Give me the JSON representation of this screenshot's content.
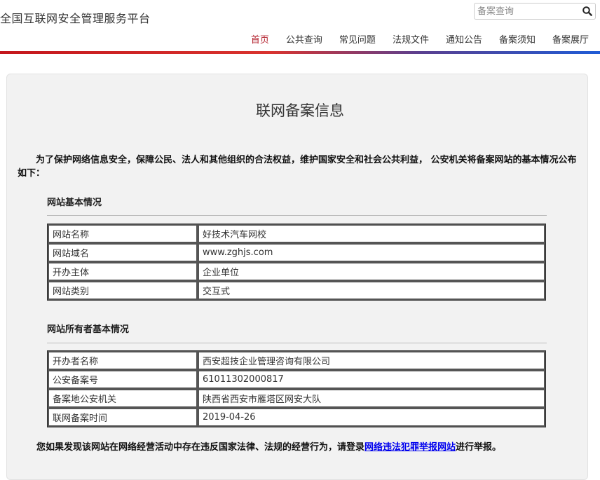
{
  "header": {
    "site_title": "全国互联网安全管理服务平台",
    "search": {
      "placeholder": "备案查询",
      "value": ""
    },
    "nav": [
      {
        "label": "首页",
        "active": true
      },
      {
        "label": "公共查询",
        "active": false
      },
      {
        "label": "常见问题",
        "active": false
      },
      {
        "label": "法规文件",
        "active": false
      },
      {
        "label": "通知公告",
        "active": false
      },
      {
        "label": "备案须知",
        "active": false
      },
      {
        "label": "备案展厅",
        "active": false
      }
    ],
    "accent_colors": [
      "#c4161c",
      "#1e5bd6"
    ],
    "active_nav_color": "#b4232f"
  },
  "main": {
    "title": "联网备案信息",
    "intro": "为了保护网络信息安全，保障公民、法人和其他组织的合法权益，维护国家安全和社会公共利益， 公安机关将备案网站的基本情况公布如下：",
    "site_section": {
      "heading": "网站基本情况",
      "rows": [
        {
          "label": "网站名称",
          "value": "好技术汽车网校"
        },
        {
          "label": "网站域名",
          "value": "www.zghjs.com"
        },
        {
          "label": "开办主体",
          "value": "企业单位"
        },
        {
          "label": "网站类别",
          "value": "交互式"
        }
      ]
    },
    "owner_section": {
      "heading": "网站所有者基本情况",
      "rows": [
        {
          "label": "开办者名称",
          "value": "西安超技企业管理咨询有限公司"
        },
        {
          "label": "公安备案号",
          "value": "61011302000817"
        },
        {
          "label": "备案地公安机关",
          "value": "陕西省西安市雁塔区网安大队"
        },
        {
          "label": "联网备案时间",
          "value": "2019-04-26"
        }
      ]
    },
    "report": {
      "prefix": "您如果发现该网站在网络经营活动中存在违反国家法律、法规的经营行为，请登录",
      "link_text": "网络违法犯罪举报网站",
      "suffix": "进行举报。"
    }
  }
}
